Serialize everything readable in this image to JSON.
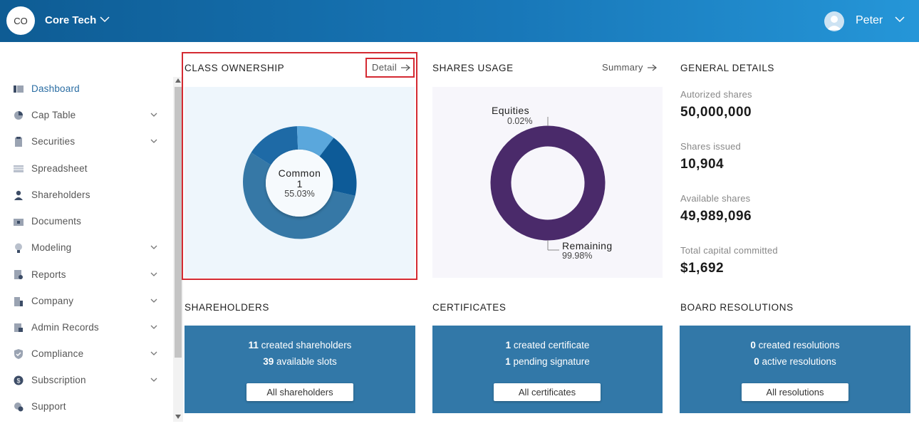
{
  "header": {
    "company_badge": "CO",
    "company_name": "Core Tech",
    "user_name": "Peter"
  },
  "sidebar": {
    "items": [
      {
        "label": "Dashboard",
        "icon": "dashboard-icon",
        "expandable": false,
        "active": true
      },
      {
        "label": "Cap Table",
        "icon": "pie-icon",
        "expandable": true
      },
      {
        "label": "Securities",
        "icon": "clipboard-icon",
        "expandable": true
      },
      {
        "label": "Spreadsheet",
        "icon": "spreadsheet-icon",
        "expandable": false
      },
      {
        "label": "Shareholders",
        "icon": "person-icon",
        "expandable": false
      },
      {
        "label": "Documents",
        "icon": "folder-lock-icon",
        "expandable": false
      },
      {
        "label": "Modeling",
        "icon": "lightbulb-icon",
        "expandable": true
      },
      {
        "label": "Reports",
        "icon": "report-icon",
        "expandable": true
      },
      {
        "label": "Company",
        "icon": "building-icon",
        "expandable": true
      },
      {
        "label": "Admin Records",
        "icon": "records-icon",
        "expandable": true
      },
      {
        "label": "Compliance",
        "icon": "shield-check-icon",
        "expandable": true
      },
      {
        "label": "Subscription",
        "icon": "dollar-circle-icon",
        "expandable": true
      },
      {
        "label": "Support",
        "icon": "support-icon",
        "expandable": false
      }
    ]
  },
  "class_ownership": {
    "title": "CLASS OWNERSHIP",
    "link": "Detail",
    "center_label": "Common",
    "center_count": "1",
    "center_percent": "55.03%"
  },
  "shares_usage": {
    "title": "SHARES USAGE",
    "link": "Summary",
    "equities_label": "Equities",
    "equities_percent": "0.02%",
    "remaining_label": "Remaining",
    "remaining_percent": "99.98%"
  },
  "general_details": {
    "title": "GENERAL DETAILS",
    "items": [
      {
        "label": "Autorized shares",
        "value": "50,000,000"
      },
      {
        "label": "Shares issued",
        "value": "10,904"
      },
      {
        "label": "Available shares",
        "value": "49,989,096"
      },
      {
        "label": "Total capital committed",
        "value": "$1,692"
      }
    ]
  },
  "shareholders": {
    "title": "SHAREHOLDERS",
    "line1_num": "11",
    "line1_text": "created shareholders",
    "line2_num": "39",
    "line2_text": "available slots",
    "button": "All shareholders"
  },
  "certificates": {
    "title": "CERTIFICATES",
    "line1_num": "1",
    "line1_text": "created certificate",
    "line2_num": "1",
    "line2_text": "pending signature",
    "button": "All certificates"
  },
  "board_resolutions": {
    "title": "BOARD RESOLUTIONS",
    "line1_num": "0",
    "line1_text": "created resolutions",
    "line2_num": "0",
    "line2_text": "active resolutions",
    "button": "All resolutions"
  },
  "colors": {
    "header_start": "#0e5c94",
    "header_end": "#2596d8",
    "card_bg": "#3278a8",
    "donut_violet": "#4a2a6a",
    "highlight_red": "#d42a32"
  }
}
